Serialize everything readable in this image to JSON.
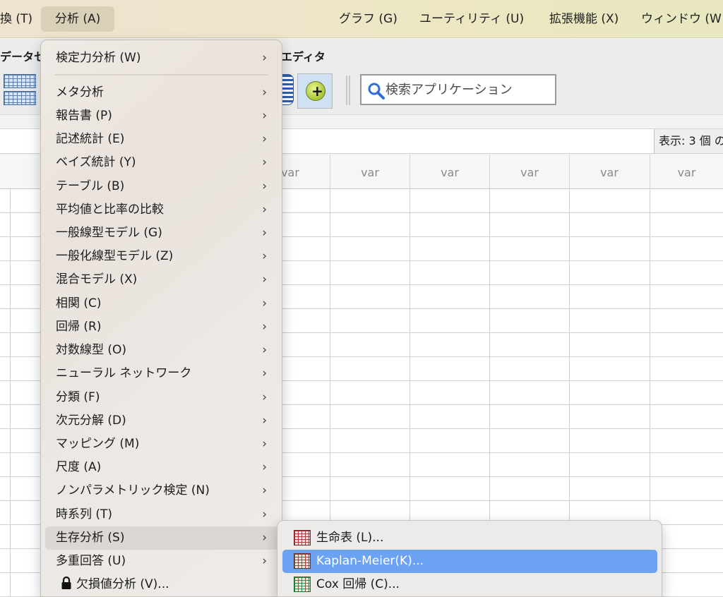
{
  "menubar": {
    "items": [
      {
        "label": "換 (T)"
      },
      {
        "label": "分析 (A)"
      },
      {
        "label": "グラフ (G)"
      },
      {
        "label": "ユーティリティ (U)"
      },
      {
        "label": "拡張機能 (X)"
      },
      {
        "label": "ウィンドウ (W"
      }
    ]
  },
  "window": {
    "title_left": "データセ",
    "title_right": "エディタ"
  },
  "toolbar": {
    "search_placeholder": "検索アプリケーション"
  },
  "status": {
    "show_count": "表示: 3 個 の"
  },
  "grid": {
    "column_headers": [
      "var",
      "var",
      "var",
      "var",
      "var",
      "var"
    ]
  },
  "analysis_menu": {
    "items": [
      {
        "label": "検定力分析 (W)",
        "has_submenu": true
      },
      {
        "label": "メタ分析",
        "has_submenu": true
      },
      {
        "label": "報告書 (P)",
        "has_submenu": true
      },
      {
        "label": "記述統計 (E)",
        "has_submenu": true
      },
      {
        "label": "ベイズ統計 (Y)",
        "has_submenu": true
      },
      {
        "label": "テーブル (B)",
        "has_submenu": true
      },
      {
        "label": "平均値と比率の比較",
        "has_submenu": true
      },
      {
        "label": "一般線型モデル (G)",
        "has_submenu": true
      },
      {
        "label": "一般化線型モデル (Z)",
        "has_submenu": true
      },
      {
        "label": "混合モデル (X)",
        "has_submenu": true
      },
      {
        "label": "相関 (C)",
        "has_submenu": true
      },
      {
        "label": "回帰 (R)",
        "has_submenu": true
      },
      {
        "label": "対数線型 (O)",
        "has_submenu": true
      },
      {
        "label": "ニューラル ネットワーク",
        "has_submenu": true
      },
      {
        "label": "分類 (F)",
        "has_submenu": true
      },
      {
        "label": "次元分解 (D)",
        "has_submenu": true
      },
      {
        "label": "マッピング (M)",
        "has_submenu": true
      },
      {
        "label": "尺度 (A)",
        "has_submenu": true
      },
      {
        "label": "ノンパラメトリック検定 (N)",
        "has_submenu": true
      },
      {
        "label": "時系列 (T)",
        "has_submenu": true
      },
      {
        "label": "生存分析 (S)",
        "has_submenu": true,
        "highlighted": true
      },
      {
        "label": "多重回答 (U)",
        "has_submenu": true
      },
      {
        "label": "欠損値分析 (V)...",
        "icon": "lock-icon"
      }
    ]
  },
  "survival_submenu": {
    "items": [
      {
        "label": "生命表 (L)...",
        "icon": "table-icon"
      },
      {
        "label": "Kaplan-Meier(K)...",
        "icon": "table-icon",
        "selected": true
      },
      {
        "label": "Cox 回帰 (C)...",
        "icon": "cox-table-icon"
      }
    ]
  },
  "colors": {
    "selection": "#6ba3f2",
    "menubar_bg": "#eee6cc"
  }
}
